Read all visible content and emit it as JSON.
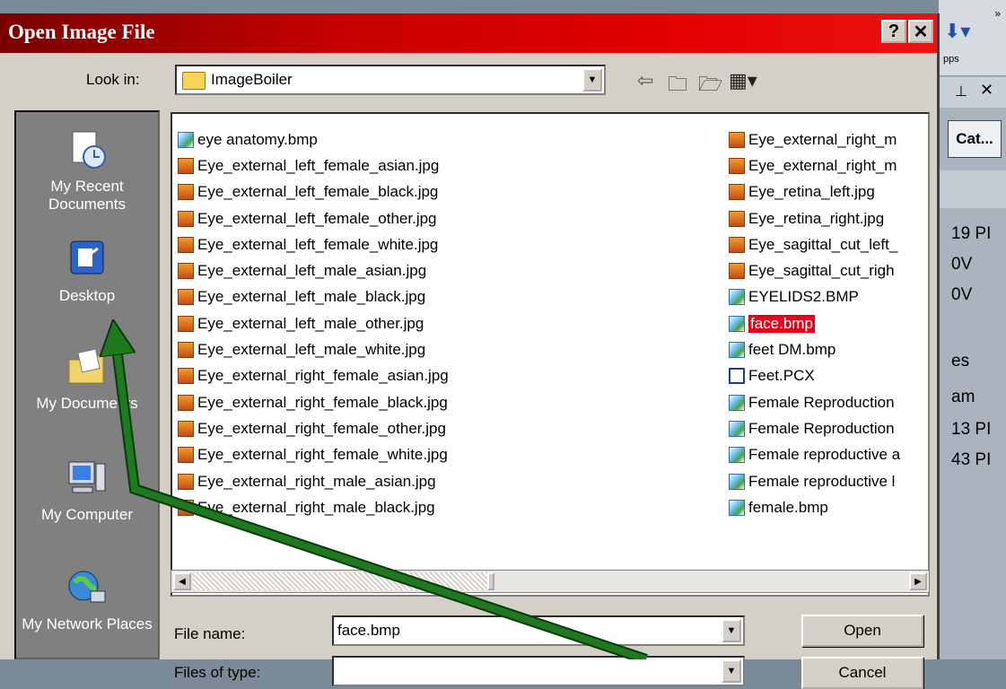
{
  "dialog": {
    "title": "Open Image File",
    "help_label": "?",
    "close_label": "✕"
  },
  "lookin": {
    "label": "Look in:",
    "value": "ImageBoiler"
  },
  "places": [
    {
      "label": "My Recent Documents"
    },
    {
      "label": "Desktop"
    },
    {
      "label": "My Documents"
    },
    {
      "label": "My Computer"
    },
    {
      "label": "My Network Places"
    }
  ],
  "files_col1": [
    {
      "name": "eye anatomy.bmp",
      "icon": "bmp"
    },
    {
      "name": "Eye_external_left_female_asian.jpg",
      "icon": "jpg"
    },
    {
      "name": "Eye_external_left_female_black.jpg",
      "icon": "jpg"
    },
    {
      "name": "Eye_external_left_female_other.jpg",
      "icon": "jpg"
    },
    {
      "name": "Eye_external_left_female_white.jpg",
      "icon": "jpg"
    },
    {
      "name": "Eye_external_left_male_asian.jpg",
      "icon": "jpg"
    },
    {
      "name": "Eye_external_left_male_black.jpg",
      "icon": "jpg"
    },
    {
      "name": "Eye_external_left_male_other.jpg",
      "icon": "jpg"
    },
    {
      "name": "Eye_external_left_male_white.jpg",
      "icon": "jpg"
    },
    {
      "name": "Eye_external_right_female_asian.jpg",
      "icon": "jpg"
    },
    {
      "name": "Eye_external_right_female_black.jpg",
      "icon": "jpg"
    },
    {
      "name": "Eye_external_right_female_other.jpg",
      "icon": "jpg"
    },
    {
      "name": "Eye_external_right_female_white.jpg",
      "icon": "jpg"
    },
    {
      "name": "Eye_external_right_male_asian.jpg",
      "icon": "jpg"
    },
    {
      "name": "Eye_external_right_male_black.jpg",
      "icon": "jpg"
    }
  ],
  "files_col2": [
    {
      "name": "Eye_external_right_m",
      "icon": "jpg"
    },
    {
      "name": "Eye_external_right_m",
      "icon": "jpg"
    },
    {
      "name": "Eye_retina_left.jpg",
      "icon": "jpg"
    },
    {
      "name": "Eye_retina_right.jpg",
      "icon": "jpg"
    },
    {
      "name": "Eye_sagittal_cut_left_",
      "icon": "jpg"
    },
    {
      "name": "Eye_sagittal_cut_righ",
      "icon": "jpg"
    },
    {
      "name": "EYELIDS2.BMP",
      "icon": "bmp"
    },
    {
      "name": "face.bmp",
      "icon": "bmp",
      "selected": true
    },
    {
      "name": "feet DM.bmp",
      "icon": "bmp"
    },
    {
      "name": "Feet.PCX",
      "icon": "pcx"
    },
    {
      "name": "Female Reproduction",
      "icon": "bmp"
    },
    {
      "name": "Female Reproduction",
      "icon": "bmp"
    },
    {
      "name": "Female reproductive a",
      "icon": "bmp"
    },
    {
      "name": "Female reproductive l",
      "icon": "bmp"
    },
    {
      "name": "female.bmp",
      "icon": "bmp"
    }
  ],
  "filename": {
    "label": "File name:",
    "value": "face.bmp"
  },
  "filetype": {
    "label": "Files of type:",
    "value": ""
  },
  "buttons": {
    "open": "Open",
    "cancel": "Cancel"
  },
  "background_app": {
    "apps_label": "pps",
    "cat_button": "Cat...",
    "listing": [
      "19 PI",
      "0V",
      "0V",
      "es",
      "am",
      "13 PI",
      "43 PI"
    ]
  },
  "colors": {
    "title_gradient_start": "#7a0000",
    "title_gradient_end": "#ee1111",
    "selection": "#e8001c",
    "annotation_arrow": "#1f7a1f"
  }
}
